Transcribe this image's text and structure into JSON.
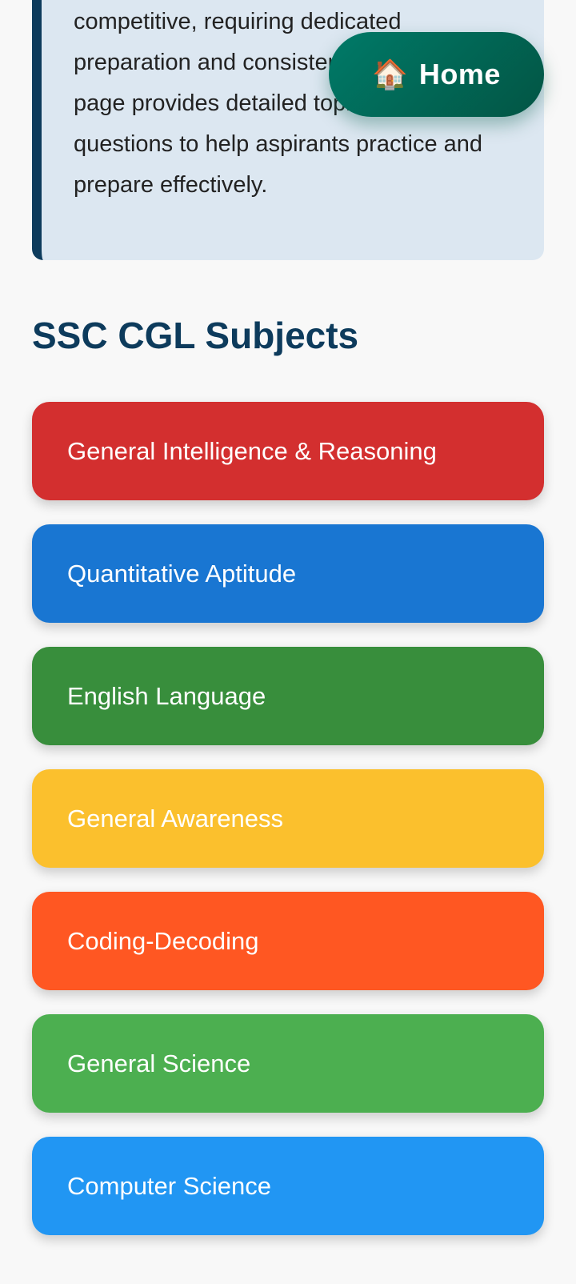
{
  "intro": {
    "text": "competitive, requiring dedicated preparation and consistent practice. This page provides detailed topics and custom questions to help aspirants practice and prepare effectively."
  },
  "home_button": {
    "icon": "house-icon",
    "icon_glyph": "🏠",
    "label": "Home"
  },
  "section": {
    "title": "SSC CGL Subjects"
  },
  "subjects": [
    {
      "label": "General Intelligence & Reasoning",
      "color": "#d32f2f"
    },
    {
      "label": "Quantitative Aptitude",
      "color": "#1976d2"
    },
    {
      "label": "English Language",
      "color": "#388e3c"
    },
    {
      "label": "General Awareness",
      "color": "#fbc02d"
    },
    {
      "label": "Coding-Decoding",
      "color": "#ff5722"
    },
    {
      "label": "General Science",
      "color": "#4caf50"
    },
    {
      "label": "Computer Science",
      "color": "#2196f3"
    }
  ]
}
